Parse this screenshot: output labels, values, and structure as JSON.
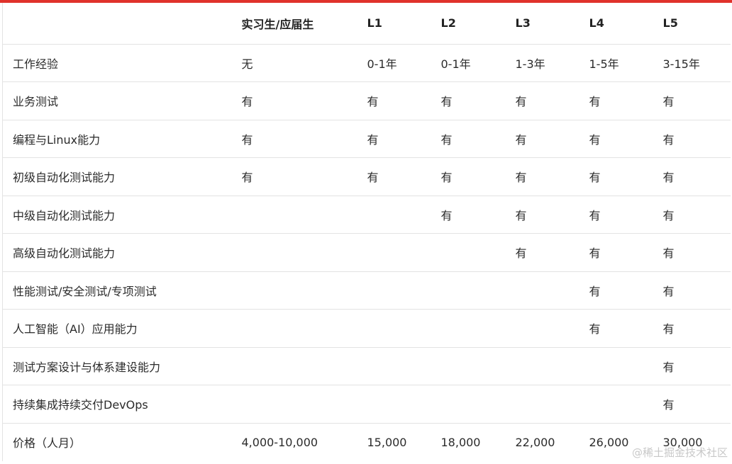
{
  "table": {
    "headers": [
      "",
      "实习生/应届生",
      "L1",
      "L2",
      "L3",
      "L4",
      "L5"
    ],
    "rows": [
      [
        "工作经验",
        "无",
        "0-1年",
        "0-1年",
        "1-3年",
        "1-5年",
        "3-15年"
      ],
      [
        "业务测试",
        "有",
        "有",
        "有",
        "有",
        "有",
        "有"
      ],
      [
        "编程与Linux能力",
        "有",
        "有",
        "有",
        "有",
        "有",
        "有"
      ],
      [
        "初级自动化测试能力",
        "有",
        "有",
        "有",
        "有",
        "有",
        "有"
      ],
      [
        "中级自动化测试能力",
        "",
        "",
        "有",
        "有",
        "有",
        "有"
      ],
      [
        "高级自动化测试能力",
        "",
        "",
        "",
        "有",
        "有",
        "有"
      ],
      [
        "性能测试/安全测试/专项测试",
        "",
        "",
        "",
        "",
        "有",
        "有"
      ],
      [
        "人工智能（AI）应用能力",
        "",
        "",
        "",
        "",
        "有",
        "有"
      ],
      [
        "测试方案设计与体系建设能力",
        "",
        "",
        "",
        "",
        "",
        "有"
      ],
      [
        "持续集成持续交付DevOps",
        "",
        "",
        "",
        "",
        "",
        "有"
      ],
      [
        "价格（人月）",
        "4,000-10,000",
        "15,000",
        "18,000",
        "22,000",
        "26,000",
        "30,000"
      ]
    ]
  },
  "watermark": "@稀土掘金技术社区",
  "colors": {
    "accent_bar": "#e0322b",
    "border": "#e3e3e3",
    "text": "#2b2b2b"
  }
}
